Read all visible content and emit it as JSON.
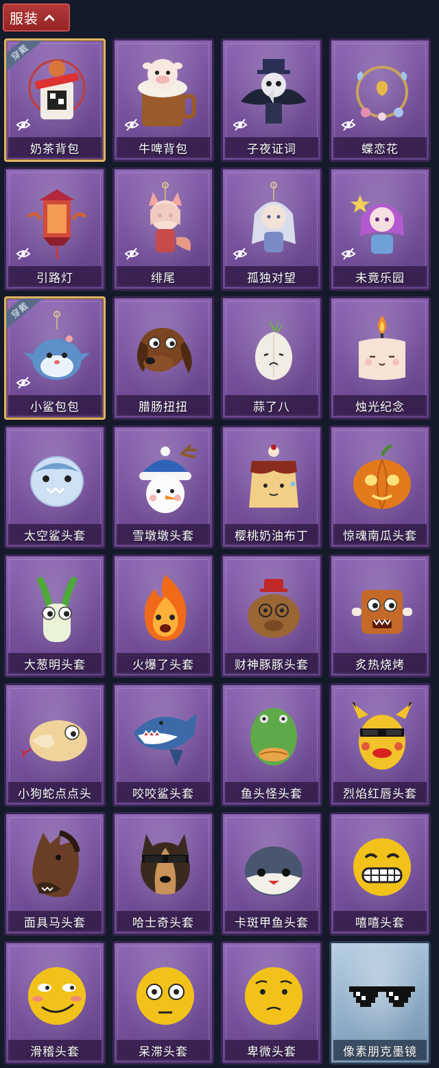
{
  "header": {
    "title": "服装",
    "toggle_icon": "chevron-up-icon"
  },
  "badge_label": "穿戴",
  "items": [
    {
      "name": "奶茶背包",
      "equipped": true,
      "hide_icon": true,
      "art": "milktea-backpack"
    },
    {
      "name": "牛啤背包",
      "equipped": false,
      "hide_icon": true,
      "art": "cow-beer-backpack"
    },
    {
      "name": "子夜证词",
      "equipped": false,
      "hide_icon": true,
      "art": "midnight-plague-doctor"
    },
    {
      "name": "蝶恋花",
      "equipped": false,
      "hide_icon": true,
      "art": "butterfly-wreath"
    },
    {
      "name": "引路灯",
      "equipped": false,
      "hide_icon": true,
      "art": "red-lantern"
    },
    {
      "name": "绯尾",
      "equipped": false,
      "hide_icon": true,
      "art": "fox-girl-pendant"
    },
    {
      "name": "孤独对望",
      "equipped": false,
      "hide_icon": true,
      "art": "silver-hair-pendant"
    },
    {
      "name": "未竟乐园",
      "equipped": false,
      "hide_icon": true,
      "art": "purple-hair-pendant"
    },
    {
      "name": "小鲨包包",
      "equipped": true,
      "hide_icon": true,
      "art": "shark-bag"
    },
    {
      "name": "腊肠扭扭",
      "equipped": false,
      "hide_icon": false,
      "art": "dachshund-head"
    },
    {
      "name": "蒜了八",
      "equipped": false,
      "hide_icon": false,
      "art": "garlic-head"
    },
    {
      "name": "烛光纪念",
      "equipped": false,
      "hide_icon": false,
      "art": "candle-head"
    },
    {
      "name": "太空鲨头套",
      "equipped": false,
      "hide_icon": false,
      "art": "space-shark-head"
    },
    {
      "name": "雪墩墩头套",
      "equipped": false,
      "hide_icon": false,
      "art": "snowman-head"
    },
    {
      "name": "樱桃奶油布丁",
      "equipped": false,
      "hide_icon": false,
      "art": "pudding-head"
    },
    {
      "name": "惊魂南瓜头套",
      "equipped": false,
      "hide_icon": false,
      "art": "pumpkin-head"
    },
    {
      "name": "大葱明头套",
      "equipped": false,
      "hide_icon": false,
      "art": "scallion-head"
    },
    {
      "name": "火爆了头套",
      "equipped": false,
      "hide_icon": false,
      "art": "fire-head"
    },
    {
      "name": "财神豚豚头套",
      "equipped": false,
      "hide_icon": false,
      "art": "capybara-head"
    },
    {
      "name": "炙热烧烤",
      "equipped": false,
      "hide_icon": false,
      "art": "bbq-head"
    },
    {
      "name": "小狗蛇点点头",
      "equipped": false,
      "hide_icon": false,
      "art": "snake-head"
    },
    {
      "name": "咬咬鲨头套",
      "equipped": false,
      "hide_icon": false,
      "art": "biting-shark-head"
    },
    {
      "name": "鱼头怪头套",
      "equipped": false,
      "hide_icon": false,
      "art": "fish-monster-head"
    },
    {
      "name": "烈焰红唇头套",
      "equipped": false,
      "hide_icon": false,
      "art": "red-lips-head"
    },
    {
      "name": "面具马头套",
      "equipped": false,
      "hide_icon": false,
      "art": "horse-mask-head"
    },
    {
      "name": "哈士奇头套",
      "equipped": false,
      "hide_icon": false,
      "art": "husky-head"
    },
    {
      "name": "卡斑甲鱼头套",
      "equipped": false,
      "hide_icon": false,
      "art": "turtle-head"
    },
    {
      "name": "嘻嘻头套",
      "equipped": false,
      "hide_icon": false,
      "art": "grin-emoji-head"
    },
    {
      "name": "滑稽头套",
      "equipped": false,
      "hide_icon": false,
      "art": "funny-emoji-head"
    },
    {
      "name": "呆滞头套",
      "equipped": false,
      "hide_icon": false,
      "art": "dazed-emoji-head"
    },
    {
      "name": "卑微头套",
      "equipped": false,
      "hide_icon": false,
      "art": "humble-emoji-head"
    },
    {
      "name": "像素朋克墨镜",
      "equipped": false,
      "hide_icon": false,
      "art": "pixel-sunglasses",
      "pixel": true
    }
  ]
}
